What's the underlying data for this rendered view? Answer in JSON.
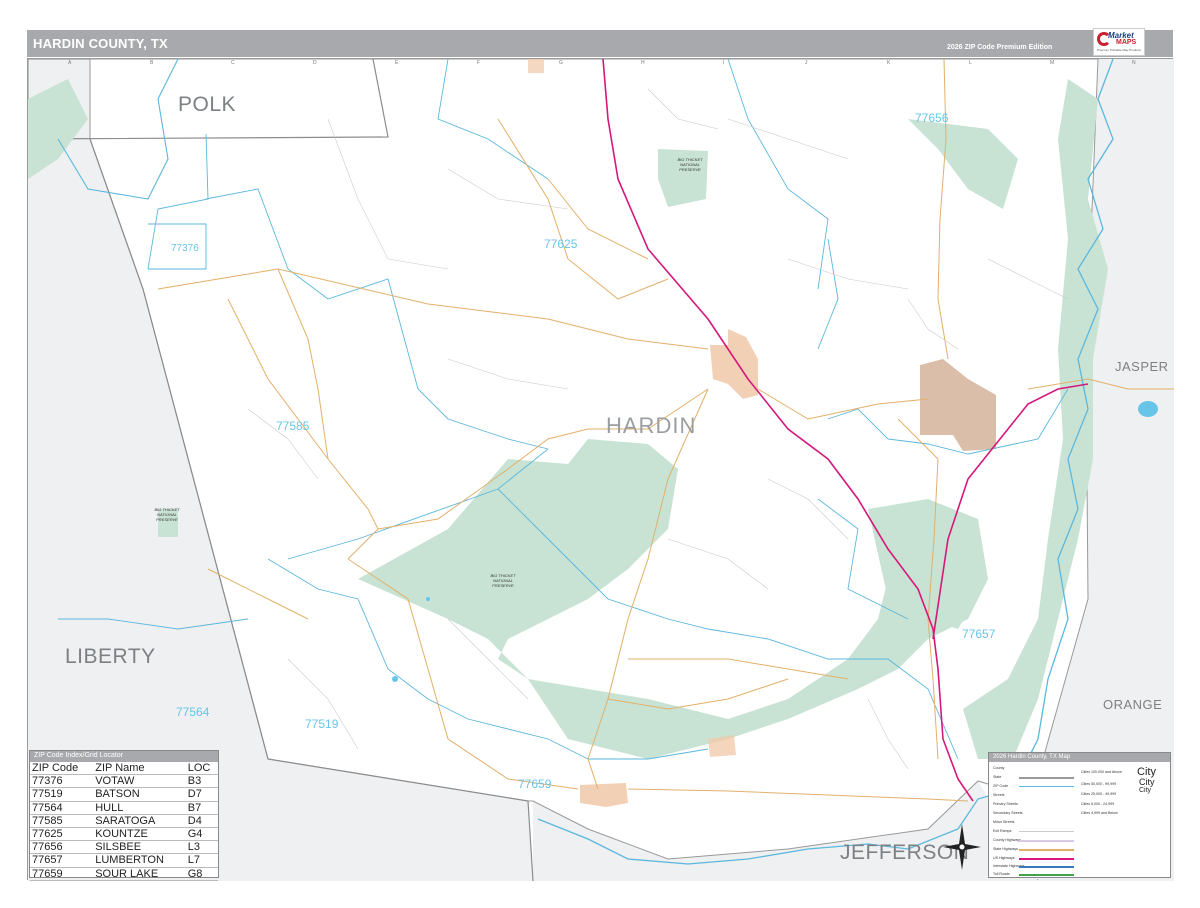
{
  "header": {
    "title": "HARDIN COUNTY, TX",
    "edition": "2026 ZIP Code Premium Edition"
  },
  "logo": {
    "brand_top": "Market",
    "brand_bottom": "MAPS",
    "tagline": "Premium Printable Map Products"
  },
  "map": {
    "county_labels": {
      "polk": "POLK",
      "hardin": "HARDIN",
      "liberty": "LIBERTY",
      "jasper": "JASPER",
      "orange": "ORANGE",
      "jefferson": "JEFFERSON"
    },
    "zip_labels": {
      "z77376": "77376",
      "z77625": "77625",
      "z77656": "77656",
      "z77585": "77585",
      "z77519": "77519",
      "z77564": "77564",
      "z77659": "77659",
      "z77657": "77657"
    },
    "preserve_labels": {
      "p1": "BIG THICKET NATIONAL PRESERVE",
      "p2": "BIG THICKET NATIONAL PRESERVE",
      "p3": "BIG THICKET NATIONAL PRESERVE"
    },
    "grid_letters": [
      "A",
      "B",
      "C",
      "D",
      "E",
      "F",
      "G",
      "H",
      "I",
      "J",
      "K",
      "L",
      "M",
      "N"
    ]
  },
  "index": {
    "heading": "ZIP Code Index/Grid Locator",
    "columns": [
      "ZIP Code",
      "ZIP Name",
      "LOC"
    ],
    "rows": [
      [
        "77376",
        "VOTAW",
        "B3"
      ],
      [
        "77519",
        "BATSON",
        "D7"
      ],
      [
        "77564",
        "HULL",
        "B7"
      ],
      [
        "77585",
        "SARATOGA",
        "D4"
      ],
      [
        "77625",
        "KOUNTZE",
        "G4"
      ],
      [
        "77656",
        "SILSBEE",
        "L3"
      ],
      [
        "77657",
        "LUMBERTON",
        "L7"
      ],
      [
        "77659",
        "SOUR LAKE",
        "G8"
      ]
    ]
  },
  "legend": {
    "heading": "2026 Hardin County, TX Map",
    "items": [
      "County",
      "State",
      "ZIP Code",
      "Streets",
      "Primary Streets",
      "Secondary Streets",
      "Minor Streets",
      "Exit Ramps",
      "County Highways",
      "State Highways",
      "US Highways",
      "Interstate Highways",
      "Toll Roads"
    ],
    "city_samples": [
      "City",
      "City",
      "City"
    ],
    "population_classes": [
      "Cities 100,000 and Above",
      "Cities 50,000 - 99,999",
      "Cities 25,000 - 49,999",
      "Cities 5,000 - 24,999",
      "Cities 4,999 and Below"
    ]
  },
  "colors": {
    "header_gray": "#a7a9ac",
    "zip_blue": "#67c5e8",
    "preserve_green": "#c8e3d3",
    "outside_county": "#eef0f2",
    "city_orange": "#f0c8a8",
    "city_brown": "#d6b7a1",
    "interstate_magenta": "#d6177c"
  }
}
